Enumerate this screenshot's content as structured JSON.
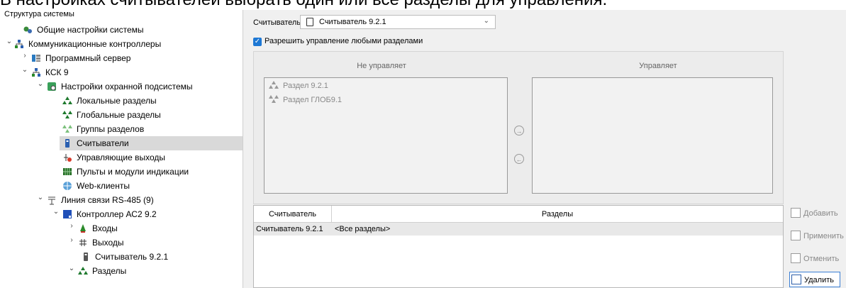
{
  "caption": "В настройках считывателей выбрать один или все разделы для управления.",
  "tree": {
    "title": "Структура системы",
    "nodes": [
      {
        "label": "Общие настройки системы",
        "icon": "gears-icon"
      },
      {
        "label": "Коммуникационные контроллеры",
        "icon": "network-icon"
      },
      {
        "label": "Программный сервер",
        "icon": "server-icon"
      },
      {
        "label": "КСК 9",
        "icon": "network-icon"
      },
      {
        "label": "Настройки охранной подсистемы",
        "icon": "security-settings-icon"
      },
      {
        "label": "Локальные разделы",
        "icon": "partitions-icon"
      },
      {
        "label": "Глобальные разделы",
        "icon": "partitions-icon"
      },
      {
        "label": "Группы разделов",
        "icon": "partition-groups-icon"
      },
      {
        "label": "Считыватели",
        "icon": "reader-icon"
      },
      {
        "label": "Управляющие выходы",
        "icon": "outputs-icon"
      },
      {
        "label": "Пульты и модули индикации",
        "icon": "panel-icon"
      },
      {
        "label": "Web-клиенты",
        "icon": "web-icon"
      },
      {
        "label": "Линия связи RS-485 (9)",
        "icon": "line-icon"
      },
      {
        "label": "Контроллер АС2 9.2",
        "icon": "controller-icon"
      },
      {
        "label": "Входы",
        "icon": "inputs-icon"
      },
      {
        "label": "Выходы",
        "icon": "outputs-icon"
      },
      {
        "label": "Считыватель 9.2.1",
        "icon": "reader-icon"
      },
      {
        "label": "Разделы",
        "icon": "partitions-icon"
      }
    ]
  },
  "reader": {
    "label": "Считыватель:",
    "value": "Считыватель 9.2.1"
  },
  "allow_any": {
    "label": "Разрешить управление любыми разделами",
    "checked": true
  },
  "not_managed": {
    "header": "Не управляет",
    "items": [
      "Раздел 9.2.1",
      "Раздел ГЛОБ9.1"
    ]
  },
  "managed": {
    "header": "Управляет",
    "items": []
  },
  "table": {
    "columns": [
      "Считыватель",
      "Разделы"
    ],
    "rows": [
      [
        "Считыватель 9.2.1",
        "<Все разделы>"
      ]
    ]
  },
  "buttons": {
    "add": "Добавить",
    "apply": "Применить",
    "cancel": "Отменить",
    "delete": "Удалить"
  },
  "colors": {
    "accent": "#1e78d4",
    "selected": "#d9d9d9"
  }
}
